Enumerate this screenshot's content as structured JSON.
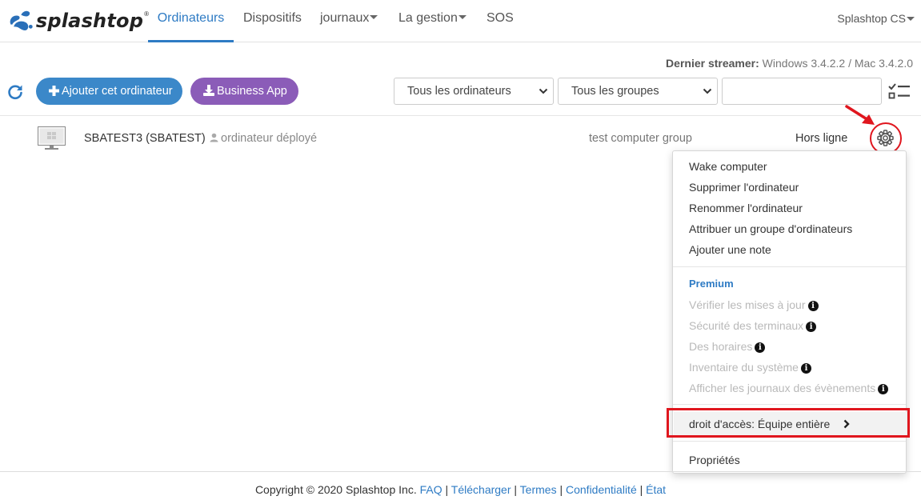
{
  "brand": {
    "name": "splashtop",
    "reg": "®"
  },
  "nav": {
    "items": [
      {
        "label": "Ordinateurs",
        "active": true
      },
      {
        "label": "Dispositifs"
      },
      {
        "label": "journaux",
        "dropdown": true
      },
      {
        "label": "La gestion",
        "dropdown": true
      },
      {
        "label": "SOS"
      }
    ],
    "account": "Splashtop CS"
  },
  "streamer": {
    "label": "Dernier streamer:",
    "windows": "Windows 3.4.2.2",
    "sep": "/",
    "mac": "Mac 3.4.2.0"
  },
  "toolbar": {
    "add_button": "Ajouter cet ordinateur",
    "business_button": "Business App",
    "filter_computers": "Tous les ordinateurs",
    "filter_groups": "Tous les groupes",
    "search_value": ""
  },
  "computer": {
    "name": "SBATEST3 (SBATEST)",
    "deploy": "ordinateur déployé",
    "group": "test computer group",
    "status": "Hors ligne"
  },
  "menu": {
    "items": [
      "Wake computer",
      "Supprimer l'ordinateur",
      "Renommer l'ordinateur",
      "Attribuer un groupe d'ordinateurs",
      "Ajouter une note"
    ],
    "premium_header": "Premium",
    "premium_items": [
      "Vérifier les mises à jour",
      "Sécurité des terminaux",
      "Des horaires",
      "Inventaire du système",
      "Afficher les journaux des évènements"
    ],
    "access": "droit d'accès: Équipe entière",
    "properties": "Propriétés"
  },
  "footer": {
    "copyright": "Copyright © 2020 Splashtop Inc.",
    "links": [
      "FAQ",
      "Télécharger",
      "Termes",
      "Confidentialité",
      "État"
    ],
    "sep": "|"
  },
  "colors": {
    "accent": "#2e7bc4",
    "primary_button": "#3b88c9",
    "business_button": "#8b5cb8",
    "highlight": "#e0161e"
  },
  "icons": [
    "splashtop-logo-icon",
    "caret-down-icon",
    "refresh-icon",
    "plus-icon",
    "download-icon",
    "chevron-down-icon",
    "checklist-icon",
    "monitor-icon",
    "user-icon",
    "gear-icon",
    "info-icon",
    "chevron-right-icon"
  ]
}
